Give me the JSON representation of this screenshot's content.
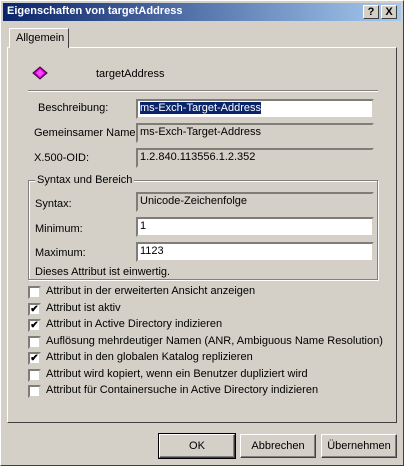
{
  "window": {
    "title": "Eigenschaften von targetAddress"
  },
  "titlebar": {
    "help_label": "?",
    "close_label": "X"
  },
  "tabs": [
    {
      "label": "Allgemein"
    }
  ],
  "header": {
    "attribute_name": "targetAddress",
    "icon": "attribute-icon"
  },
  "fields": {
    "beschreibung": {
      "label": "Beschreibung:",
      "value": "ms-Exch-Target-Address"
    },
    "gemeinsamer_name": {
      "label": "Gemeinsamer Name:",
      "value": "ms-Exch-Target-Address"
    },
    "x500_oid": {
      "label": "X.500-OID:",
      "value": "1.2.840.113556.1.2.352"
    }
  },
  "syntax_group": {
    "title": "Syntax und Bereich",
    "syntax": {
      "label": "Syntax:",
      "value": "Unicode-Zeichenfolge"
    },
    "minimum": {
      "label": "Minimum:",
      "value": "1"
    },
    "maximum": {
      "label": "Maximum:",
      "value": "1123"
    },
    "note": "Dieses Attribut ist einwertig."
  },
  "checkboxes": [
    {
      "label": "Attribut in der erweiterten Ansicht anzeigen",
      "checked": false
    },
    {
      "label": "Attribut ist aktiv",
      "checked": true
    },
    {
      "label": "Attribut in Active Directory indizieren",
      "checked": true
    },
    {
      "label": "Auflösung mehrdeutiger Namen (ANR, Ambiguous Name Resolution)",
      "checked": false
    },
    {
      "label": "Attribut in den globalen Katalog replizieren",
      "checked": true
    },
    {
      "label": "Attribut wird kopiert, wenn ein Benutzer dupliziert wird",
      "checked": false
    },
    {
      "label": "Attribut für Containersuche in Active Directory indizieren",
      "checked": false
    }
  ],
  "buttons": {
    "ok": "OK",
    "cancel": "Abbrechen",
    "apply": "Übernehmen"
  }
}
